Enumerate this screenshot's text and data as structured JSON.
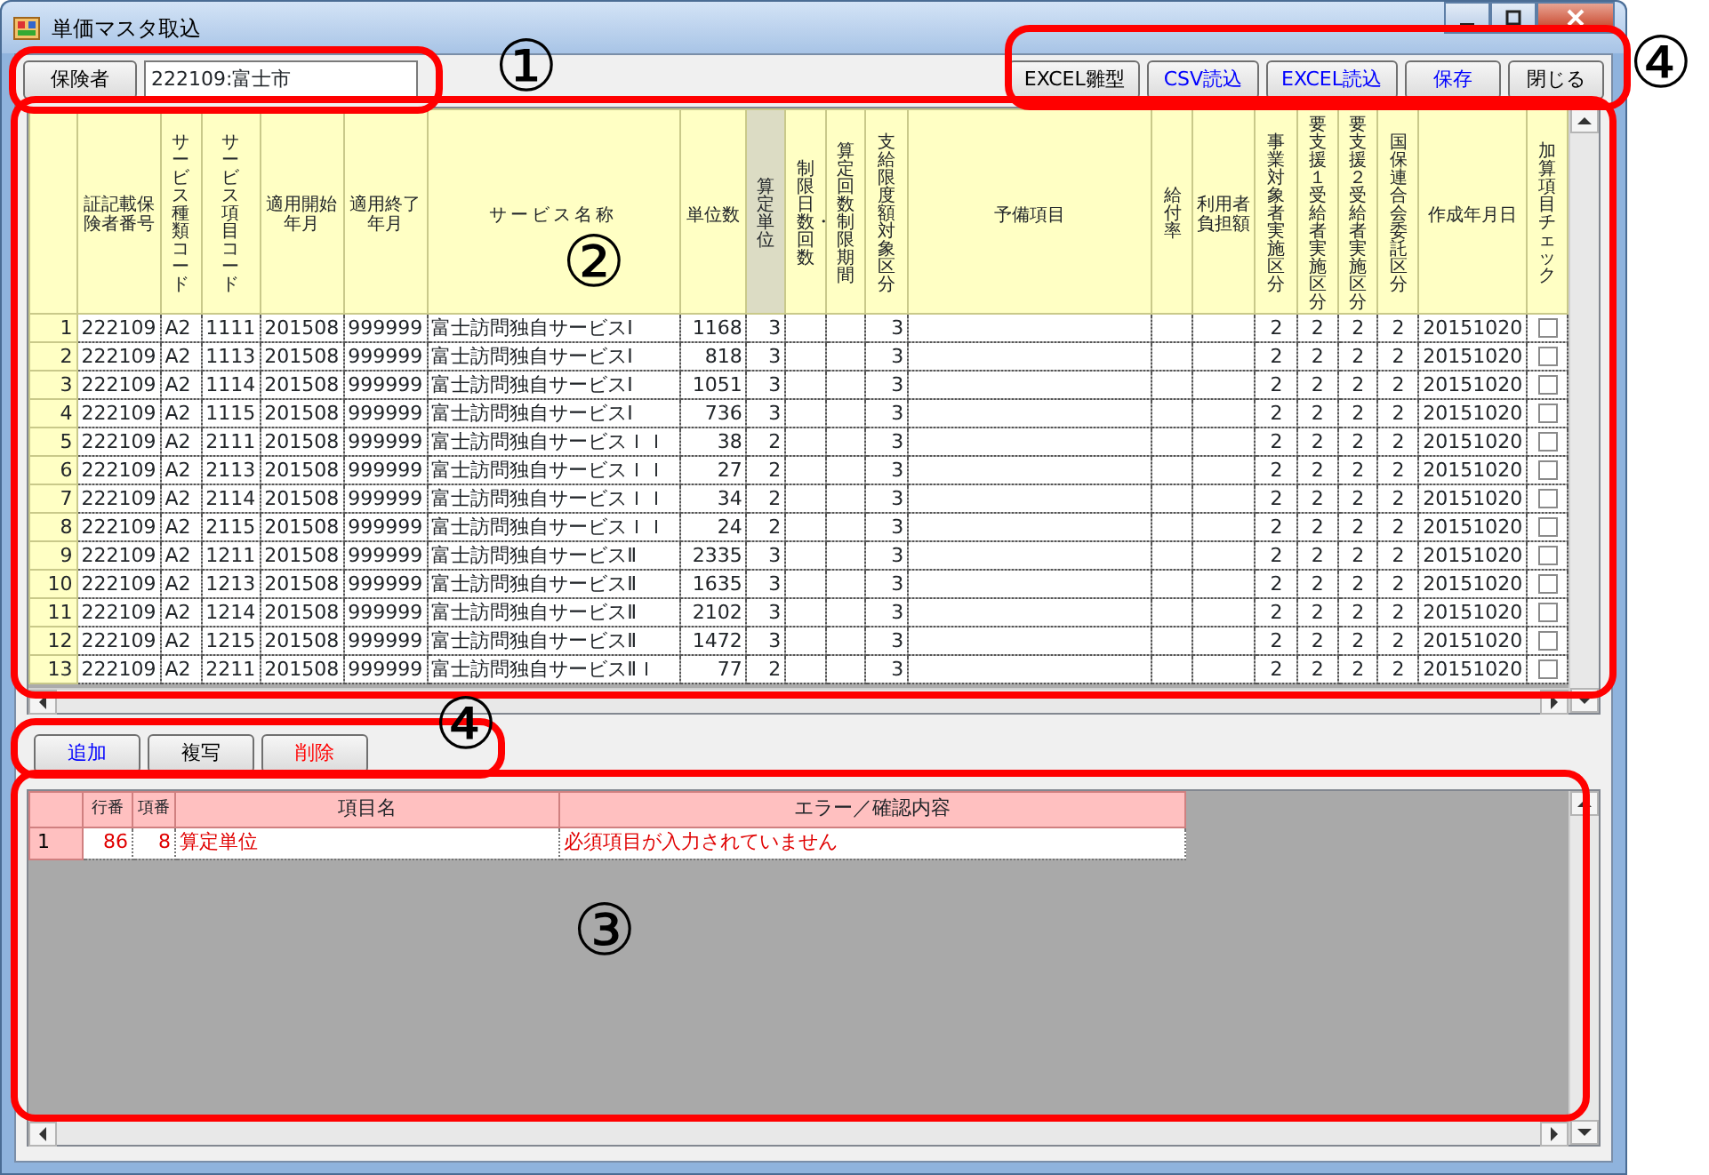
{
  "window": {
    "title": "単価マスタ取込"
  },
  "insurer": {
    "button": "保険者",
    "value": "222109:富士市"
  },
  "toolbar_buttons": [
    {
      "label": "EXCEL雛型",
      "color": "#000000"
    },
    {
      "label": "CSV読込",
      "color": "#0000ff"
    },
    {
      "label": "EXCEL読込",
      "color": "#0000ff"
    },
    {
      "label": "保存",
      "color": "#0000ff"
    },
    {
      "label": "閉じる",
      "color": "#000000"
    }
  ],
  "master_table": {
    "columns": [
      {
        "label": "証記載保険者番号",
        "selected": false
      },
      {
        "label": "サービス種類コード",
        "selected": false
      },
      {
        "label": "サービス項目コード",
        "selected": false
      },
      {
        "label": "適用開始年月",
        "selected": false
      },
      {
        "label": "適用終了年月",
        "selected": false
      },
      {
        "label": "サービス名称",
        "selected": false
      },
      {
        "label": "単位数",
        "selected": false
      },
      {
        "label": "算定単位",
        "selected": true
      },
      {
        "label": "制限日数・回数",
        "selected": false
      },
      {
        "label": "算定回数制限期間",
        "selected": false
      },
      {
        "label": "支給限度額対象区分",
        "selected": false
      },
      {
        "label": "予備項目",
        "selected": false
      },
      {
        "label": "給付率",
        "selected": false
      },
      {
        "label": "利用者負担額",
        "selected": false
      },
      {
        "label": "事業対象者実施区分",
        "selected": false
      },
      {
        "label": "要支援１受給者実施区分",
        "selected": false
      },
      {
        "label": "要支援２受給者実施区分",
        "selected": false
      },
      {
        "label": "国保連合会委託区分",
        "selected": false
      },
      {
        "label": "作成年月日",
        "selected": false
      },
      {
        "label": "加算項目チェック",
        "selected": false
      }
    ],
    "rows": [
      {
        "row_number": "1",
        "cells": [
          "222109",
          "A2",
          "1111",
          "201508",
          "999999",
          "富士訪問独自サービスⅠ",
          "1168",
          "3",
          null,
          null,
          "3",
          null,
          null,
          null,
          "2",
          "2",
          "2",
          "2",
          "20151020"
        ],
        "checked": false
      },
      {
        "row_number": "2",
        "cells": [
          "222109",
          "A2",
          "1113",
          "201508",
          "999999",
          "富士訪問独自サービスⅠ",
          "818",
          "3",
          null,
          null,
          "3",
          null,
          null,
          null,
          "2",
          "2",
          "2",
          "2",
          "20151020"
        ],
        "checked": false
      },
      {
        "row_number": "3",
        "cells": [
          "222109",
          "A2",
          "1114",
          "201508",
          "999999",
          "富士訪問独自サービスⅠ",
          "1051",
          "3",
          null,
          null,
          "3",
          null,
          null,
          null,
          "2",
          "2",
          "2",
          "2",
          "20151020"
        ],
        "checked": false
      },
      {
        "row_number": "4",
        "cells": [
          "222109",
          "A2",
          "1115",
          "201508",
          "999999",
          "富士訪問独自サービスⅠ",
          "736",
          "3",
          null,
          null,
          "3",
          null,
          null,
          null,
          "2",
          "2",
          "2",
          "2",
          "20151020"
        ],
        "checked": false
      },
      {
        "row_number": "5",
        "cells": [
          "222109",
          "A2",
          "2111",
          "201508",
          "999999",
          "富士訪問独自サービスＩＩ",
          "38",
          "2",
          null,
          null,
          "3",
          null,
          null,
          null,
          "2",
          "2",
          "2",
          "2",
          "20151020"
        ],
        "checked": false
      },
      {
        "row_number": "6",
        "cells": [
          "222109",
          "A2",
          "2113",
          "201508",
          "999999",
          "富士訪問独自サービスＩＩ",
          "27",
          "2",
          null,
          null,
          "3",
          null,
          null,
          null,
          "2",
          "2",
          "2",
          "2",
          "20151020"
        ],
        "checked": false
      },
      {
        "row_number": "7",
        "cells": [
          "222109",
          "A2",
          "2114",
          "201508",
          "999999",
          "富士訪問独自サービスＩＩ",
          "34",
          "2",
          null,
          null,
          "3",
          null,
          null,
          null,
          "2",
          "2",
          "2",
          "2",
          "20151020"
        ],
        "checked": false
      },
      {
        "row_number": "8",
        "cells": [
          "222109",
          "A2",
          "2115",
          "201508",
          "999999",
          "富士訪問独自サービスＩＩ",
          "24",
          "2",
          null,
          null,
          "3",
          null,
          null,
          null,
          "2",
          "2",
          "2",
          "2",
          "20151020"
        ],
        "checked": false
      },
      {
        "row_number": "9",
        "cells": [
          "222109",
          "A2",
          "1211",
          "201508",
          "999999",
          "富士訪問独自サービスⅡ",
          "2335",
          "3",
          null,
          null,
          "3",
          null,
          null,
          null,
          "2",
          "2",
          "2",
          "2",
          "20151020"
        ],
        "checked": false
      },
      {
        "row_number": "10",
        "cells": [
          "222109",
          "A2",
          "1213",
          "201508",
          "999999",
          "富士訪問独自サービスⅡ",
          "1635",
          "3",
          null,
          null,
          "3",
          null,
          null,
          null,
          "2",
          "2",
          "2",
          "2",
          "20151020"
        ],
        "checked": false
      },
      {
        "row_number": "11",
        "cells": [
          "222109",
          "A2",
          "1214",
          "201508",
          "999999",
          "富士訪問独自サービスⅡ",
          "2102",
          "3",
          null,
          null,
          "3",
          null,
          null,
          null,
          "2",
          "2",
          "2",
          "2",
          "20151020"
        ],
        "checked": false
      },
      {
        "row_number": "12",
        "cells": [
          "222109",
          "A2",
          "1215",
          "201508",
          "999999",
          "富士訪問独自サービスⅡ",
          "1472",
          "3",
          null,
          null,
          "3",
          null,
          null,
          null,
          "2",
          "2",
          "2",
          "2",
          "20151020"
        ],
        "checked": false
      },
      {
        "row_number": "13",
        "cells": [
          "222109",
          "A2",
          "2211",
          "201508",
          "999999",
          "富士訪問独自サービスⅡＩ",
          "77",
          "2",
          null,
          null,
          "3",
          null,
          null,
          null,
          "2",
          "2",
          "2",
          "2",
          "20151020"
        ],
        "checked": false
      }
    ]
  },
  "row_buttons": [
    {
      "label": "追加",
      "color": "#0000ff"
    },
    {
      "label": "複写",
      "color": "#000000"
    },
    {
      "label": "削除",
      "color": "#ff0000"
    }
  ],
  "error_table": {
    "columns": [
      "行番",
      "項番",
      "項目名",
      "エラー／確認内容"
    ],
    "rows": [
      {
        "row_number": "1",
        "cells": [
          "86",
          "8",
          "算定単位",
          "必須項目が入力されていません"
        ]
      }
    ]
  },
  "annotations": [
    {
      "label": "①"
    },
    {
      "label": "④"
    },
    {
      "label": "②"
    },
    {
      "label": "④"
    },
    {
      "label": "③"
    }
  ]
}
